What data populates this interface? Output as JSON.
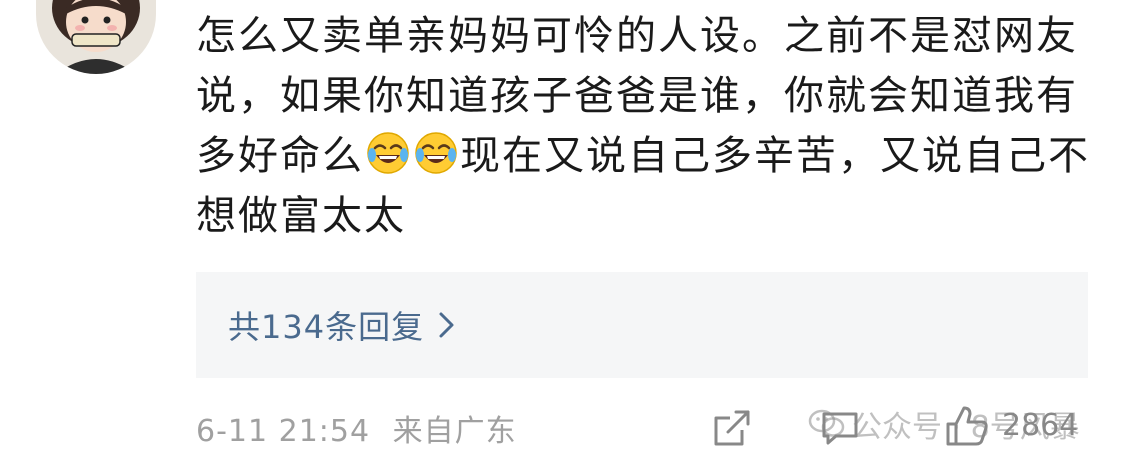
{
  "comment": {
    "text_part1": "怎么又卖单亲妈妈可怜的人设。之前不是怼网友说，如果你知道孩子爸爸是谁，你就会知道我有多好命么",
    "emojis": [
      "laugh-cry-emoji",
      "laugh-cry-emoji"
    ],
    "text_part2": "现在又说自己多辛苦，又说自己不想做富太太"
  },
  "replies": {
    "label": "共134条回复"
  },
  "meta": {
    "timestamp": "6-11 21:54",
    "source": "来自广东"
  },
  "actions": {
    "like_count": "2864"
  },
  "watermark": {
    "text": "公众号 · 8号风暴"
  },
  "colors": {
    "reply_link": "#4a6a8e",
    "reply_bg": "#f5f6f7",
    "meta_text": "#a0a0a0",
    "body_text": "#1a1a1a"
  },
  "icons": {
    "share": "share-icon",
    "comment": "comment-icon",
    "like": "thumbs-up-icon",
    "chevron": "chevron-right-icon"
  }
}
